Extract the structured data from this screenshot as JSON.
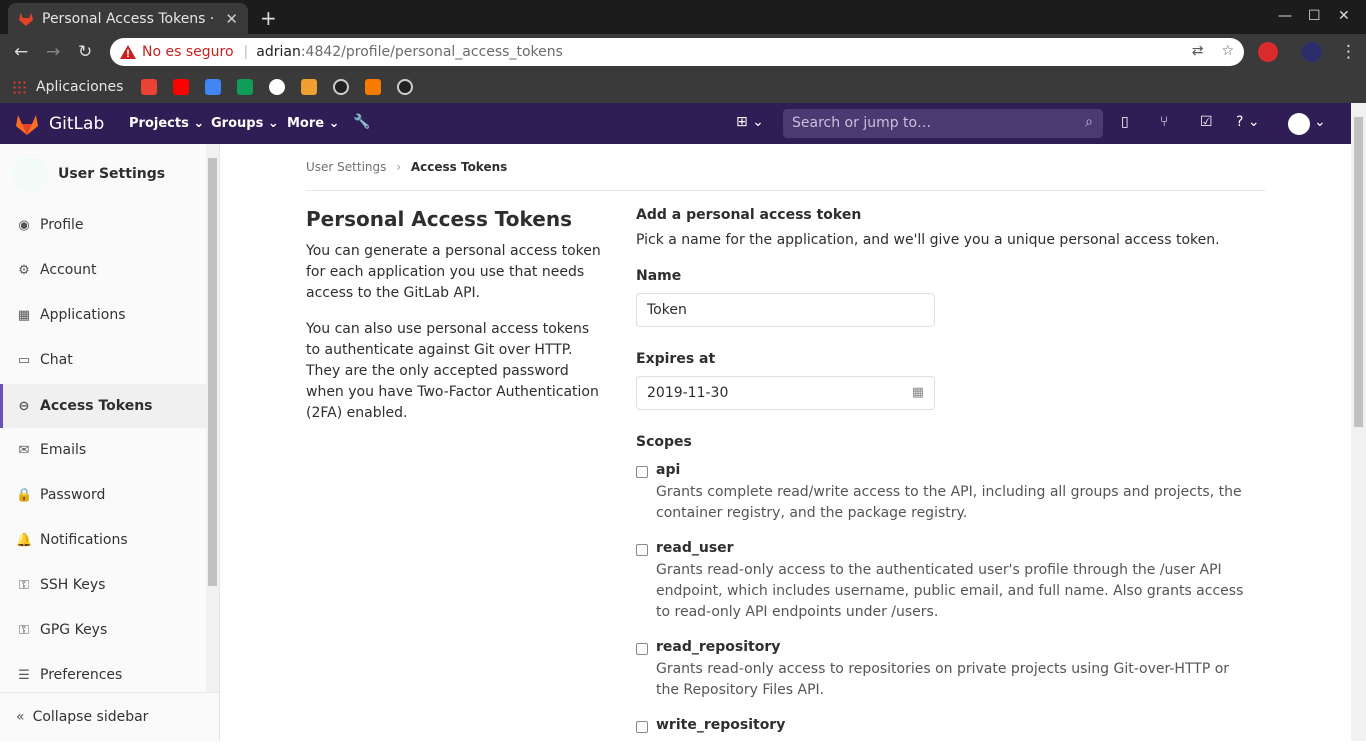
{
  "browser": {
    "tab_title": "Personal Access Tokens · U",
    "insecure_label": "No es seguro",
    "host": "adrian",
    "path": ":4842/profile/personal_access_tokens",
    "bookmarks_label": "Aplicaciones"
  },
  "header": {
    "brand": "GitLab",
    "nav": [
      "Projects",
      "Groups",
      "More"
    ],
    "search_placeholder": "Search or jump to…"
  },
  "sidebar": {
    "title": "User Settings",
    "items": [
      {
        "label": "Profile",
        "icon": "profile-icon"
      },
      {
        "label": "Account",
        "icon": "account-icon"
      },
      {
        "label": "Applications",
        "icon": "applications-icon"
      },
      {
        "label": "Chat",
        "icon": "chat-icon"
      },
      {
        "label": "Access Tokens",
        "icon": "token-icon"
      },
      {
        "label": "Emails",
        "icon": "mail-icon"
      },
      {
        "label": "Password",
        "icon": "lock-icon"
      },
      {
        "label": "Notifications",
        "icon": "bell-icon"
      },
      {
        "label": "SSH Keys",
        "icon": "key-icon"
      },
      {
        "label": "GPG Keys",
        "icon": "key-icon"
      },
      {
        "label": "Preferences",
        "icon": "preferences-icon"
      }
    ],
    "collapse": "Collapse sidebar"
  },
  "breadcrumb": {
    "parent": "User Settings",
    "current": "Access Tokens"
  },
  "intro": {
    "title": "Personal Access Tokens",
    "p1": "You can generate a personal access token for each application you use that needs access to the GitLab API.",
    "p2": "You can also use personal access tokens to authenticate against Git over HTTP. They are the only accepted password when you have Two-Factor Authentication (2FA) enabled."
  },
  "form": {
    "heading": "Add a personal access token",
    "lead": "Pick a name for the application, and we'll give you a unique personal access token.",
    "name_label": "Name",
    "name_value": "Token",
    "expires_label": "Expires at",
    "expires_value": "2019-11-30",
    "scopes_label": "Scopes",
    "scopes": [
      {
        "name": "api",
        "desc": "Grants complete read/write access to the API, including all groups and projects, the container registry, and the package registry."
      },
      {
        "name": "read_user",
        "desc": "Grants read-only access to the authenticated user's profile through the /user API endpoint, which includes username, public email, and full name. Also grants access to read-only API endpoints under /users."
      },
      {
        "name": "read_repository",
        "desc": "Grants read-only access to repositories on private projects using Git-over-HTTP or the Repository Files API."
      },
      {
        "name": "write_repository",
        "desc": ""
      }
    ]
  },
  "colors": {
    "header_bg": "#2f1d55",
    "accent": "#6b4fbb",
    "insecure": "#c5221f"
  }
}
